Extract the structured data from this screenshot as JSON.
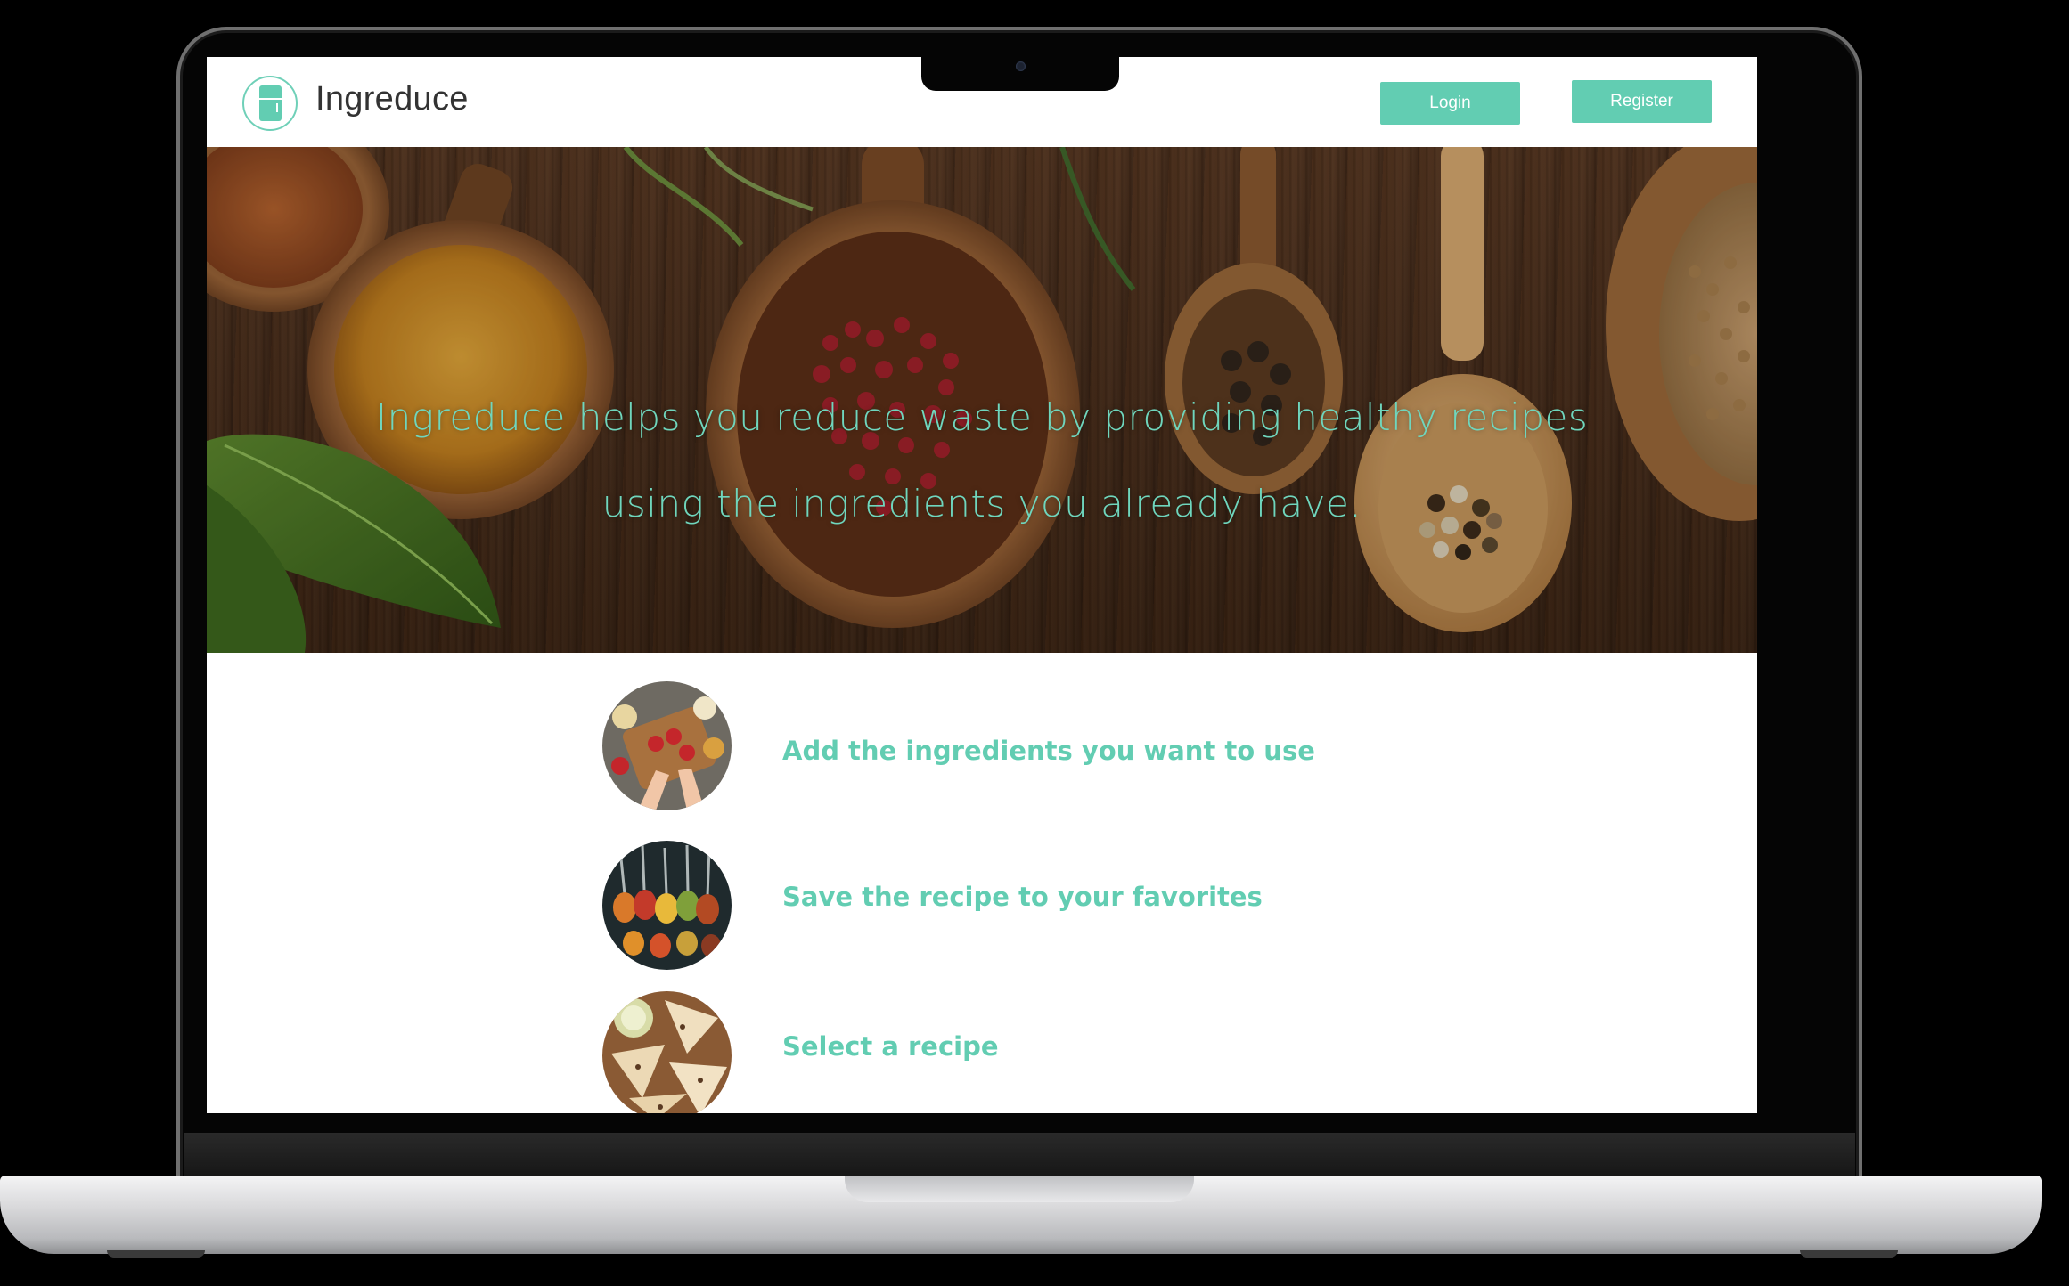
{
  "header": {
    "brand": "Ingreduce",
    "login_label": "Login",
    "register_label": "Register"
  },
  "hero": {
    "line1": "Ingreduce helps you reduce waste by providing healthy recipes",
    "line2": "using the ingredients you already have."
  },
  "steps": [
    {
      "text": "Add the ingredients you want to use"
    },
    {
      "text": "Save the recipe to your favorites"
    },
    {
      "text": "Select a recipe"
    }
  ],
  "colors": {
    "accent": "#62cdb2",
    "brand_text": "#333333"
  }
}
